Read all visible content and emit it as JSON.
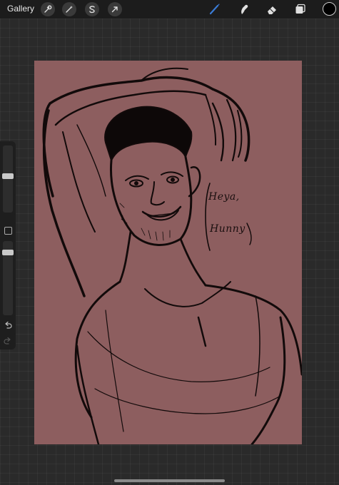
{
  "toolbar": {
    "gallery_label": "Gallery",
    "left_tools": [
      "wrench-icon",
      "magic-wand-icon",
      "selection-s-icon",
      "transform-arrow-icon"
    ],
    "right_tools": [
      "brush-icon",
      "smudge-icon",
      "eraser-icon",
      "layers-icon",
      "color-swatch"
    ],
    "active_tool": "brush",
    "accent_color": "#3a7bd5",
    "current_color": "#000000"
  },
  "sidebar": {
    "brush_size_level": 0.55,
    "opacity_level": 0.88,
    "items": [
      "brush-size-slider",
      "modify-button",
      "opacity-slider",
      "undo-button",
      "redo-button"
    ]
  },
  "canvas": {
    "background_color": "#8d5e5f",
    "speech_line1": "Heya,",
    "speech_line2": "Hunny"
  }
}
